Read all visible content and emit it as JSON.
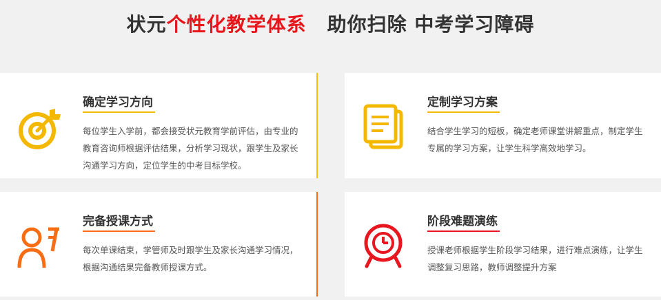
{
  "headline": {
    "part1": "状元",
    "part2": "个性化教学体系",
    "part3": "助你扫除 中考学习障碍"
  },
  "colors": {
    "accent_red": "#e8151b",
    "yellow": "#f5b800",
    "orange": "#f86c14",
    "red": "#e8161e"
  },
  "cards": [
    {
      "icon": "target-icon",
      "title": "确定学习方向",
      "lines": [
        "每位学生入学前，都会接受状元教育学前评估，由专业的",
        "教育咨询师根据评估结果，分析学习现状，跟学生及家长",
        "沟通学习方向，定位学生的中考目标学校。"
      ]
    },
    {
      "icon": "document-icon",
      "title": "定制学习方案",
      "lines": [
        "结合学生学习的短板，确定老师课堂讲解重点，制定学生",
        "专属的学习方案，让学生科学高效地学习。"
      ]
    },
    {
      "icon": "teacher-icon",
      "title": "完备授课方式",
      "lines": [
        "每次单课结束，学管师及时跟学生及家长沟通学习情况，",
        "根据沟通结果完备教师授课方式。"
      ]
    },
    {
      "icon": "clock-icon",
      "title": "阶段难题演练",
      "lines": [
        "授课老师根据学生阶段学习结果，进行难点演练，让学生",
        "调整复习思路，教师调整提升方案"
      ]
    }
  ]
}
